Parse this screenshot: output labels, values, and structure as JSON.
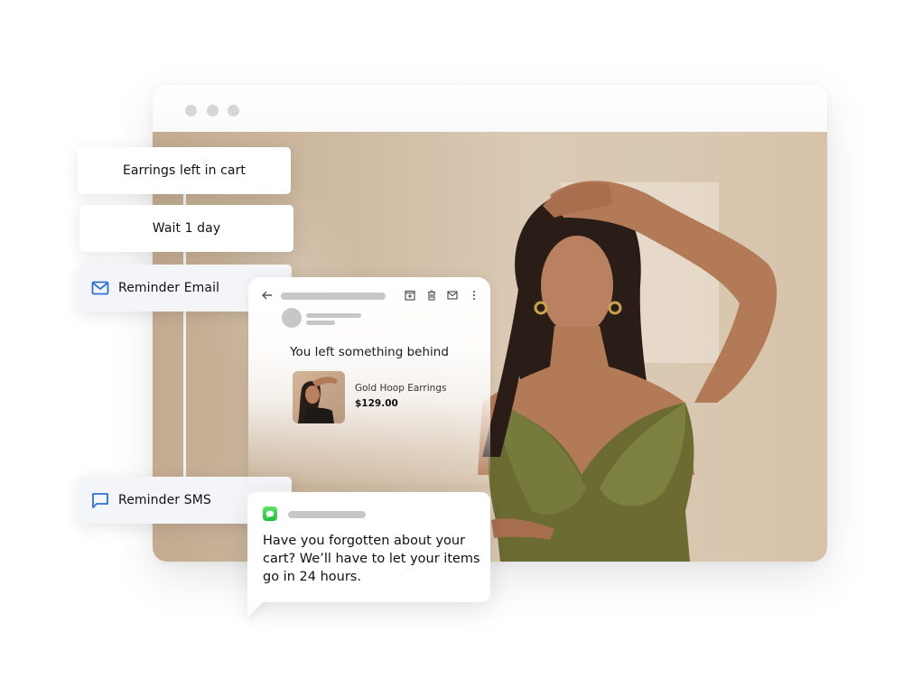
{
  "browser": {
    "window_controls": [
      "dot",
      "dot",
      "dot"
    ]
  },
  "flow": {
    "steps": [
      {
        "label": "Earrings left in cart",
        "type": "trigger"
      },
      {
        "label": "Wait 1 day",
        "type": "delay"
      },
      {
        "label": "Reminder Email",
        "type": "action",
        "icon": "mail-icon"
      },
      {
        "label": "Reminder SMS",
        "type": "action",
        "icon": "chat-bubble-icon"
      }
    ],
    "accent_color": "#2f6fd6"
  },
  "email": {
    "toolbar_icons": [
      "back-arrow-icon",
      "archive-icon",
      "trash-icon",
      "mail-icon",
      "more-vertical-icon"
    ],
    "heading": "You left something behind",
    "product": {
      "name": "Gold Hoop Earrings",
      "price": "$129.00"
    }
  },
  "sms": {
    "app_icon": "messages-icon",
    "app_icon_color": "#28c840",
    "message": "Have you forgotten about your cart? We’ll have to let your items go in 24 hours."
  }
}
